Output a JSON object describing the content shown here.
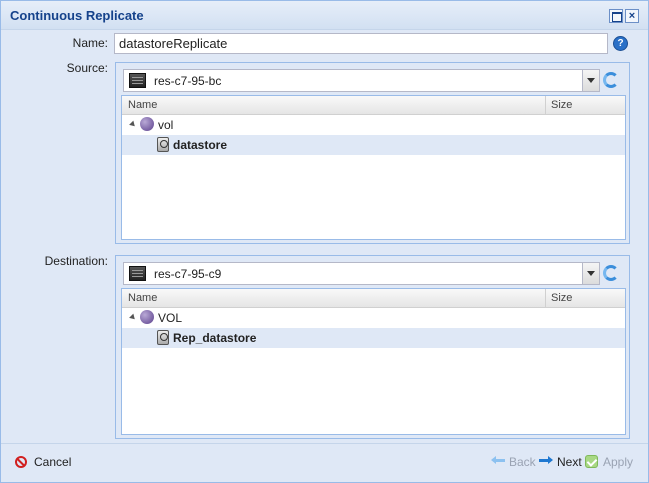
{
  "window": {
    "title": "Continuous Replicate"
  },
  "form": {
    "name_label": "Name:",
    "name_value": "datastoreReplicate",
    "source_label": "Source:",
    "destination_label": "Destination:"
  },
  "source": {
    "server": "res-c7-95-bc",
    "columns": [
      "Name",
      "Size"
    ],
    "pool": "vol",
    "dataset": "datastore"
  },
  "destination": {
    "server": "res-c7-95-c9",
    "columns": [
      "Name",
      "Size"
    ],
    "pool": "VOL",
    "dataset": "Rep_datastore"
  },
  "footer": {
    "cancel": "Cancel",
    "back": "Back",
    "next": "Next",
    "apply": "Apply"
  },
  "colors": {
    "title": "#15428b",
    "panel_bg": "#dfe8f6",
    "border": "#99bbe8"
  }
}
